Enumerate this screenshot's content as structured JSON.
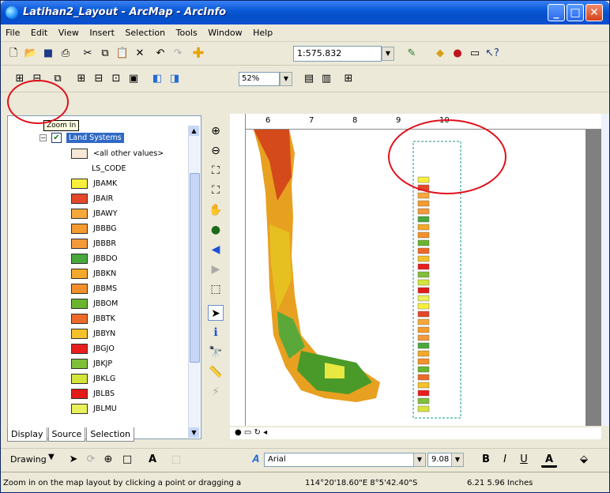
{
  "window": {
    "title": "Latihan2_Layout - ArcMap - ArcInfo"
  },
  "menu": [
    "File",
    "Edit",
    "View",
    "Insert",
    "Selection",
    "Tools",
    "Window",
    "Help"
  ],
  "toolbar": {
    "scale": "1:575.832",
    "zoom": "52%"
  },
  "tooltip": "Zoom In",
  "toc": {
    "layer": "Land Systems",
    "other_values": "<all other values>",
    "field": "LS_CODE",
    "items": [
      {
        "label": "JBAMK",
        "color": "#f7ef3c"
      },
      {
        "label": "JBAIR",
        "color": "#e4472a"
      },
      {
        "label": "JBAWY",
        "color": "#f8a83a"
      },
      {
        "label": "JBBBG",
        "color": "#f59a2e"
      },
      {
        "label": "JBBBR",
        "color": "#f49a3c"
      },
      {
        "label": "JBBDO",
        "color": "#49a83c"
      },
      {
        "label": "JBBKN",
        "color": "#f4a92a"
      },
      {
        "label": "JBBMS",
        "color": "#f48f2a"
      },
      {
        "label": "JBBOM",
        "color": "#69b52f"
      },
      {
        "label": "JBBTK",
        "color": "#ee6a28"
      },
      {
        "label": "JBBYN",
        "color": "#f5c12a"
      },
      {
        "label": "JBGJO",
        "color": "#e81e1e"
      },
      {
        "label": "JBKJP",
        "color": "#7fbf3a"
      },
      {
        "label": "JBKLG",
        "color": "#d5e43a"
      },
      {
        "label": "JBLBS",
        "color": "#e21a1a"
      },
      {
        "label": "JBLMU",
        "color": "#e9f05a"
      }
    ],
    "tabs": [
      "Display",
      "Source",
      "Selection"
    ]
  },
  "ruler": {
    "top": [
      "6",
      "7",
      "8",
      "9",
      "10"
    ]
  },
  "drawing": {
    "label": "Drawing",
    "font": "Arial",
    "size": "9.08"
  },
  "status": {
    "message": "Zoom in on the map layout by clicking a point or dragging a",
    "coords": "114°20'18.60\"E 8°5'42.40\"S",
    "size": "6.21 5.96 Inches"
  },
  "colors": {
    "title": "#0a5ad8",
    "accent": "#e0101a"
  }
}
